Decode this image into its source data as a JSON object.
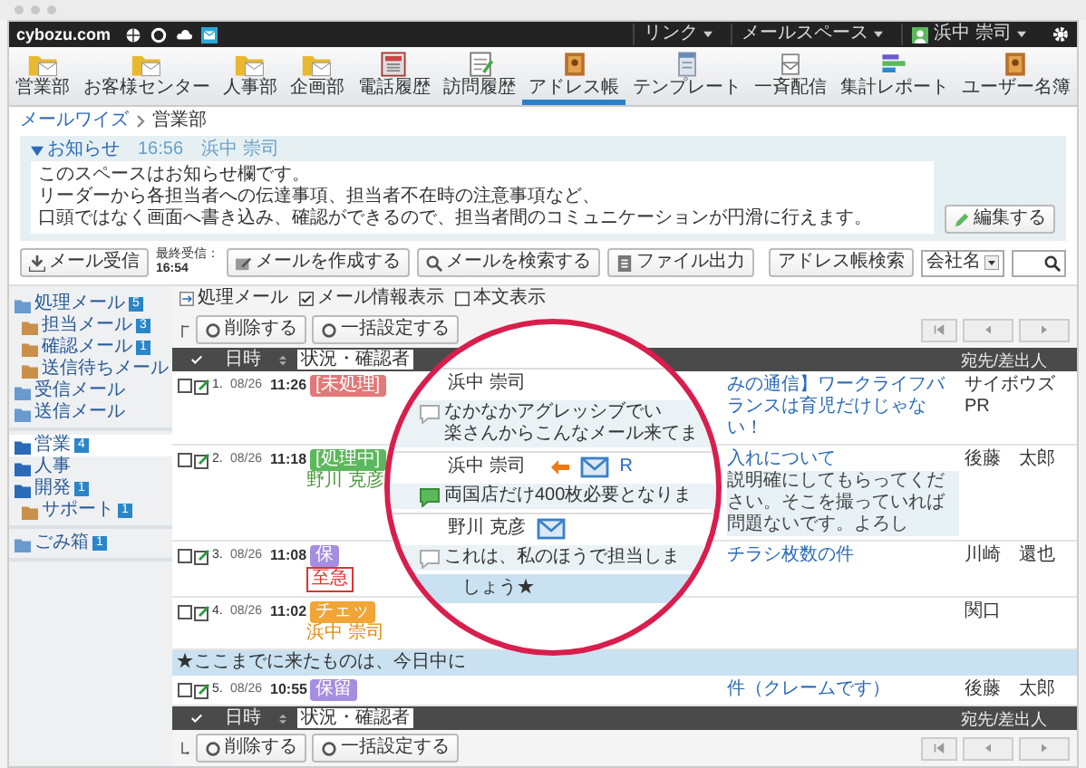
{
  "topbar": {
    "logo": "cybozu.com",
    "menus": [
      {
        "label": "リンク",
        "kind": "menu"
      },
      {
        "label": "メールスペース",
        "kind": "menu"
      },
      {
        "label": "浜中 崇司",
        "kind": "user"
      }
    ]
  },
  "apps": [
    {
      "label": "営業部",
      "kind": "folder",
      "selected": false
    },
    {
      "label": "お客様センター",
      "kind": "folder",
      "selected": false
    },
    {
      "label": "人事部",
      "kind": "folder",
      "selected": false
    },
    {
      "label": "企画部",
      "kind": "folder",
      "selected": false
    },
    {
      "label": "電話履歴",
      "kind": "phone",
      "selected": false
    },
    {
      "label": "訪問履歴",
      "kind": "memo",
      "selected": false
    },
    {
      "label": "アドレス帳",
      "kind": "book",
      "selected": true
    },
    {
      "label": "テンプレート",
      "kind": "template",
      "selected": false
    },
    {
      "label": "一斉配信",
      "kind": "broadcast",
      "selected": false
    },
    {
      "label": "集計レポート",
      "kind": "report",
      "selected": false
    },
    {
      "label": "ユーザー名簿",
      "kind": "book",
      "selected": false
    }
  ],
  "breadcrumb": {
    "root": "メールワイズ",
    "current": "営業部"
  },
  "notice": {
    "title": "お知らせ",
    "expanded": true,
    "time": "16:56",
    "author": "浜中 崇司",
    "lines": [
      "このスペースはお知らせ欄です。",
      "リーダーから各担当者への伝達事項、担当者不在時の注意事項など、",
      "口頭ではなく画面へ書き込み、確認ができるので、担当者間のコミュニケーションが円滑に行えます。"
    ],
    "edit": "編集する"
  },
  "toolbar": {
    "receive": "メール受信",
    "last_label": "最終受信：",
    "last_time": "16:54",
    "buttons": [
      "メールを作成する",
      "メールを検索する",
      "ファイル出力"
    ],
    "address_search": "アドレス帳検索",
    "select": "会社名"
  },
  "sidebar": [
    [
      {
        "label": "処理メール",
        "count": "5",
        "selected": false,
        "children": [
          {
            "label": "担当メール",
            "count": "3",
            "selected": false
          },
          {
            "label": "確認メール",
            "count": "1",
            "selected": false
          },
          {
            "label": "送信待ちメール",
            "selected": false
          }
        ]
      },
      {
        "label": "受信メール",
        "selected": false
      },
      {
        "label": "送信メール",
        "selected": false
      }
    ],
    [
      {
        "label": "営業",
        "count": "4",
        "selected": true
      },
      {
        "label": "人事",
        "selected": false
      },
      {
        "label": "開発",
        "count": "1",
        "selected": false,
        "children": [
          {
            "label": "サポート",
            "count": "1",
            "selected": false
          }
        ]
      }
    ],
    [
      {
        "label": "ごみ箱",
        "count": "1",
        "selected": false
      }
    ]
  ],
  "list": {
    "options": [
      {
        "label": "処理メール",
        "kind": "link"
      },
      {
        "label": "メール情報表示",
        "kind": "check",
        "checked": true
      },
      {
        "label": "本文表示",
        "kind": "check",
        "checked": false
      }
    ],
    "actions": [
      "削除する",
      "一括設定する"
    ],
    "columns": {
      "date": "日時",
      "status": "状況・確認者",
      "sender": "宛先/差出人"
    },
    "rows": [
      {
        "kind": "mail",
        "checked": false,
        "num": "1.",
        "date": "08/26",
        "time": "11:26",
        "status": "[未処理]",
        "color": "#e27878",
        "subject": "みの通信】ワークライフバランスは育児だけじゃない！",
        "sender": "サイボウズPR"
      },
      {
        "kind": "mail",
        "checked": false,
        "num": "2.",
        "date": "08/26",
        "time": "11:18",
        "status": "[処理中]",
        "color": "#5cb85c",
        "checker": "野川 克彦",
        "subject": "入れについて",
        "preview": "説明確にしてもらってください。そこを撮っていれば問題ないです。よろし",
        "sender": "後藤　太郎"
      },
      {
        "kind": "mail",
        "checked": false,
        "num": "3.",
        "date": "08/26",
        "time": "11:08",
        "status": "保",
        "color": "#a58de0",
        "tag": "至急",
        "subject": "チラシ枚数の件",
        "sender": "川崎　還也"
      },
      {
        "kind": "mail",
        "checked": false,
        "num": "4.",
        "date": "08/26",
        "time": "11:02",
        "status": "チェッ",
        "color": "#f0a535",
        "assignee": "浜中 崇司",
        "sender": "関口"
      },
      {
        "kind": "banner",
        "text": "★ここまでに来たものは、今日中に"
      },
      {
        "kind": "mail",
        "checked": false,
        "num": "5.",
        "date": "08/26",
        "time": "10:55",
        "status": "保留",
        "color": "#a58de0",
        "subject": "件（クレームです）",
        "sender": "後藤　太郎"
      }
    ],
    "footer_columns": {
      "date": "日時",
      "status": "状況・確認者",
      "sender": "宛先/差出人"
    },
    "footer_actions": [
      "削除する",
      "一括設定する"
    ]
  },
  "magnifier": {
    "items": [
      {
        "author": "浜中 崇司",
        "arrow": false,
        "mail_icon": false,
        "comment": [
          "なかなかアグレッシブでい",
          "楽さんからこんなメール来てま"
        ],
        "new_comment": false
      },
      {
        "author": "浜中 崇司",
        "arrow": true,
        "mail_icon": true,
        "subject": "R",
        "comment": [
          "両国店だけ400枚必要となりま"
        ],
        "new_comment": true
      },
      {
        "author": "野川 克彦",
        "arrow": false,
        "mail_icon": true,
        "comment": [
          "これは、私のほうで担当しま"
        ],
        "new_comment": false
      }
    ],
    "banner": "しょう★"
  }
}
